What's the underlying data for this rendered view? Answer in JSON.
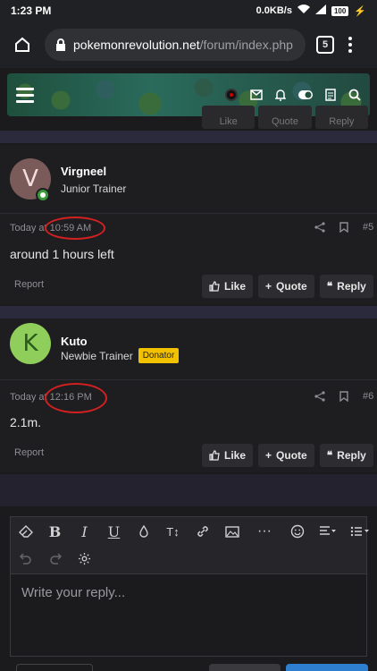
{
  "status_bar": {
    "time": "1:23 PM",
    "network": "0.0KB/s",
    "battery": "100"
  },
  "browser": {
    "url_host": "pokemonrevolution.net",
    "url_path": "/forum/index.php",
    "tab_count": "5"
  },
  "prev_post": {
    "like": "Like",
    "quote": "Quote",
    "reply": "Reply"
  },
  "posts": [
    {
      "avatar_letter": "V",
      "avatar_color": "#7b5a5a",
      "username": "Virgneel",
      "user_title": "Junior Trainer",
      "badge": "",
      "time_prefix": "Today at",
      "time": "10:59 AM",
      "post_number": "#5",
      "message": "around 1 hours left",
      "report": "Report",
      "like": "Like",
      "quote": "Quote",
      "reply": "Reply"
    },
    {
      "avatar_letter": "K",
      "avatar_color": "#8fce5a",
      "username": "Kuto",
      "user_title": "Newbie Trainer",
      "badge": "Donator",
      "time_prefix": "Today at",
      "time": "12:16 PM",
      "post_number": "#6",
      "message": "2.1m.",
      "report": "Report",
      "like": "Like",
      "quote": "Quote",
      "reply": "Reply"
    }
  ],
  "editor": {
    "placeholder": "Write your reply...",
    "text_size_glyph": "T↕",
    "more_glyph": "···"
  },
  "colors": {
    "accent_badge": "#f2c200",
    "annotation_circle": "#d42020",
    "online": "#3a9a3a"
  }
}
